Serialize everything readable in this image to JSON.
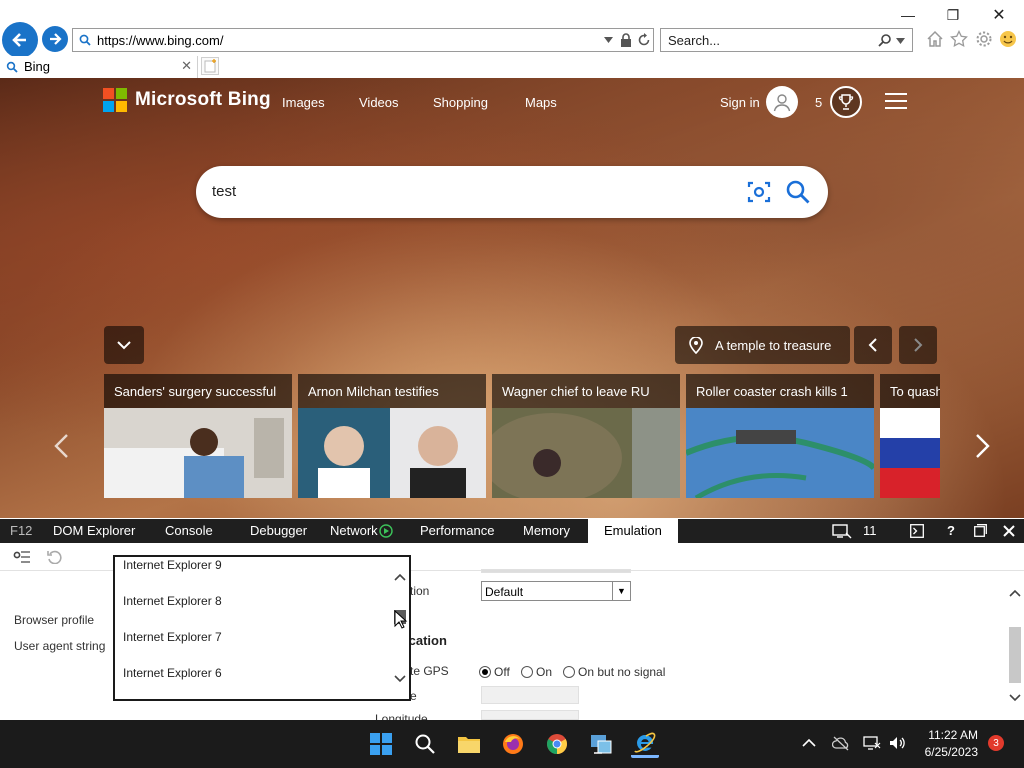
{
  "browser": {
    "address_url": "https://www.bing.com/",
    "search_placeholder": "Search...",
    "tab_title": "Bing",
    "window_controls": {
      "minimize": "—",
      "maximize": "❐",
      "close": "✕"
    }
  },
  "bing": {
    "brand": "Microsoft Bing",
    "nav": [
      "Images",
      "Videos",
      "Shopping",
      "Maps"
    ],
    "sign_in": "Sign in",
    "rewards_count": "5",
    "search_query": "test",
    "location_label": "A temple to treasure",
    "news": [
      {
        "title": "Sanders' surgery successful"
      },
      {
        "title": "Arnon Milchan testifies"
      },
      {
        "title": "Wagner chief to leave RU"
      },
      {
        "title": "Roller coaster crash kills 1"
      },
      {
        "title": "To quash"
      }
    ],
    "logo_colors": [
      "#f25022",
      "#7fba00",
      "#00a4ef",
      "#ffb900"
    ]
  },
  "devtools": {
    "tabs": {
      "f12": "F12",
      "dom": "DOM Explorer",
      "console": "Console",
      "debugger": "Debugger",
      "network": "Network",
      "performance": "Performance",
      "memory": "Memory",
      "emulation": "Emulation"
    },
    "target_count": "11",
    "help": "?",
    "labels": {
      "browser_profile": "Browser profile",
      "user_agent": "User agent string",
      "orientation_frag": "tion",
      "geolocation_frag": "ication",
      "simulate_gps_frag": "te GPS",
      "latitude_frag": "e",
      "longitude": "Longitude"
    },
    "orientation_value": "Default",
    "gps_options": [
      "Off",
      "On",
      "On but no signal"
    ],
    "gps_selected": 0,
    "ua_options": [
      "Internet Explorer 9",
      "Internet Explorer 8",
      "Internet Explorer 7",
      "Internet Explorer 6"
    ]
  },
  "taskbar": {
    "time": "11:22 AM",
    "date": "6/25/2023",
    "notifications": "3"
  }
}
